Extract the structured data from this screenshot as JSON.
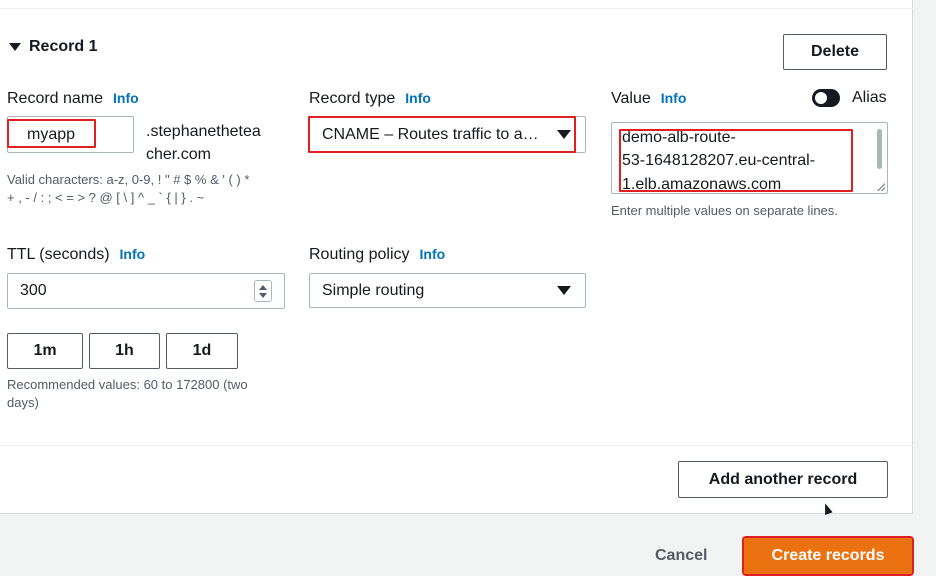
{
  "record": {
    "title": "Record 1",
    "delete_label": "Delete"
  },
  "record_name": {
    "label": "Record name",
    "info": "Info",
    "value": "myapp",
    "domain_line1": ".stephanethetea",
    "domain_line2": "cher.com",
    "hint_line1": "Valid characters: a-z, 0-9, ! \" # $ % & ' ( ) *",
    "hint_line2": "+ , - / : ; < = > ? @ [ \\ ] ^ _ ` { | } . ~"
  },
  "record_type": {
    "label": "Record type",
    "info": "Info",
    "value": "CNAME – Routes traffic to a…"
  },
  "value_field": {
    "label": "Value",
    "info": "Info",
    "alias_label": "Alias",
    "line1": "demo-alb-route-",
    "line2": "53-1648128207.eu-central-",
    "line3": "1.elb.amazonaws.com",
    "hint": "Enter multiple values on separate lines."
  },
  "ttl": {
    "label": "TTL (seconds)",
    "info": "Info",
    "value": "300",
    "quick_buttons": [
      "1m",
      "1h",
      "1d"
    ],
    "hint_line1": "Recommended values: 60 to 172800 (two",
    "hint_line2": "days)"
  },
  "routing": {
    "label": "Routing policy",
    "info": "Info",
    "value": "Simple routing"
  },
  "footer": {
    "add_record_label": "Add another record",
    "cancel_label": "Cancel",
    "create_label": "Create records"
  },
  "colors": {
    "accent": "#0073bb",
    "primary": "#ec7211",
    "highlight": "#e02020"
  }
}
